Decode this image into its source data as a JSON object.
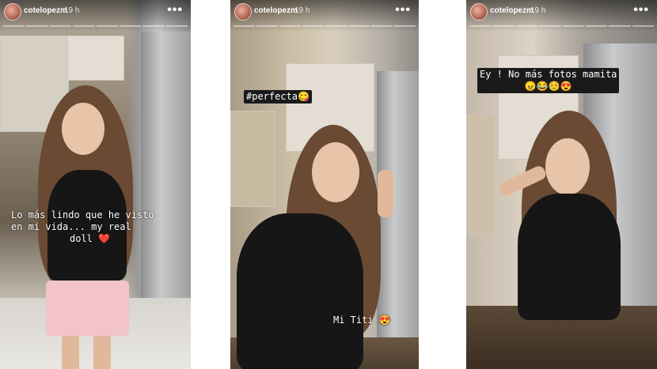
{
  "stories": [
    {
      "username": "cotelopezm",
      "time": "19 h",
      "more": "•••",
      "caption_lines": [
        "Lo más lindo que he visto",
        "en mi vida... my real",
        "doll"
      ],
      "caption_emoji": "❤️"
    },
    {
      "username": "cotelopezm",
      "time": "19 h",
      "more": "•••",
      "hashtag": "#perfecta",
      "hashtag_emoji": "😋",
      "caption": "Mi Titi",
      "caption_emoji": "😍"
    },
    {
      "username": "cotelopezm",
      "time": "19 h",
      "more": "•••",
      "caption": "Ey ! No más fotos mamita",
      "caption_emojis": "😠😂☺️😍"
    }
  ],
  "colors": {
    "text": "#ffffff",
    "caption_box": "#1a1a1a",
    "heart": "#e0202b"
  }
}
